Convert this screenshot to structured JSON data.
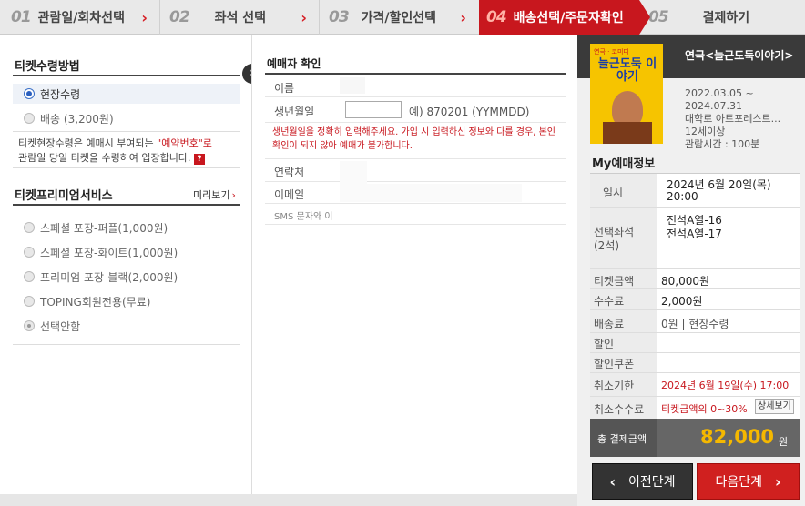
{
  "steps": [
    {
      "num": "01",
      "label": "관람일/회차선택"
    },
    {
      "num": "02",
      "label": "좌석 선택"
    },
    {
      "num": "03",
      "label": "가격/할인선택"
    },
    {
      "num": "04",
      "label": "배송선택/주문자확인"
    },
    {
      "num": "05",
      "label": "결제하기"
    }
  ],
  "left": {
    "receive_title": "티켓수령방법",
    "options": [
      "현장수령",
      "배송 (3,200원)"
    ],
    "note_prefix": "티켓현장수령은 예매시 부여되는 ",
    "note_highlight": "\"예약번호\"로",
    "note_suffix": "관람일 당일 티켓을 수령하여 입장합니다.",
    "help_icon": "?",
    "premium_title": "티켓프리미엄서비스",
    "preview_link": "미리보기",
    "premium_options": [
      "스페셜 포장-퍼플(1,000원)",
      "스페셜 포장-화이트(1,000원)",
      "프리미엄 포장-블랙(2,000원)",
      "TOPING회원전용(무료)",
      "선택안함"
    ]
  },
  "mid": {
    "title": "예매자 확인",
    "name_label": "이름",
    "birth_label": "생년월일",
    "birth_example": "예) 870201 (YYMMDD)",
    "birth_warning": "생년월일을 정확히 입력해주세요. 가입 시 입력하신 정보와 다를 경우, 본인확인이 되지 않아 예매가 불가합니다.",
    "contact_label": "연락처",
    "email_label": "이메일",
    "sms_label": "SMS 문자와 이"
  },
  "right": {
    "poster_text": "늘근도둑 이야기",
    "poster_top": "연극 · 코미디",
    "show_title": "연극<늘근도둑이야기>",
    "period_start": "2022.03.05 ~",
    "period_end": "2024.07.31",
    "venue": "대학로 아트포레스트...",
    "age": "12세이상",
    "runtime": "관람시간 : 100분",
    "my_title": "My예매정보",
    "date_label": "일시",
    "date_value1": "2024년 6월 20일(목)",
    "date_value2": "20:00",
    "seat_label1": "선택좌석",
    "seat_label2": "(2석)",
    "seat1": "전석A열-16",
    "seat2": "전석A열-17",
    "ticket_label": "티켓금액",
    "ticket_value": "80,000원",
    "fee_label": "수수료",
    "fee_value": "2,000원",
    "ship_label": "배송료",
    "ship_value": "0원 | 현장수령",
    "disc_label": "할인",
    "coupon_label": "할인쿠폰",
    "cancel_label": "취소기한",
    "cancel_value": "2024년 6월 19일(수) 17:00",
    "cancelfee_label": "취소수수료",
    "cancelfee_value": "티켓금액의 0~30%",
    "detail_btn": "상세보기",
    "total_label": "총 결제금액",
    "total_value": "82,000",
    "total_unit": "원",
    "prev_btn": "이전단계",
    "next_btn": "다음단계"
  }
}
